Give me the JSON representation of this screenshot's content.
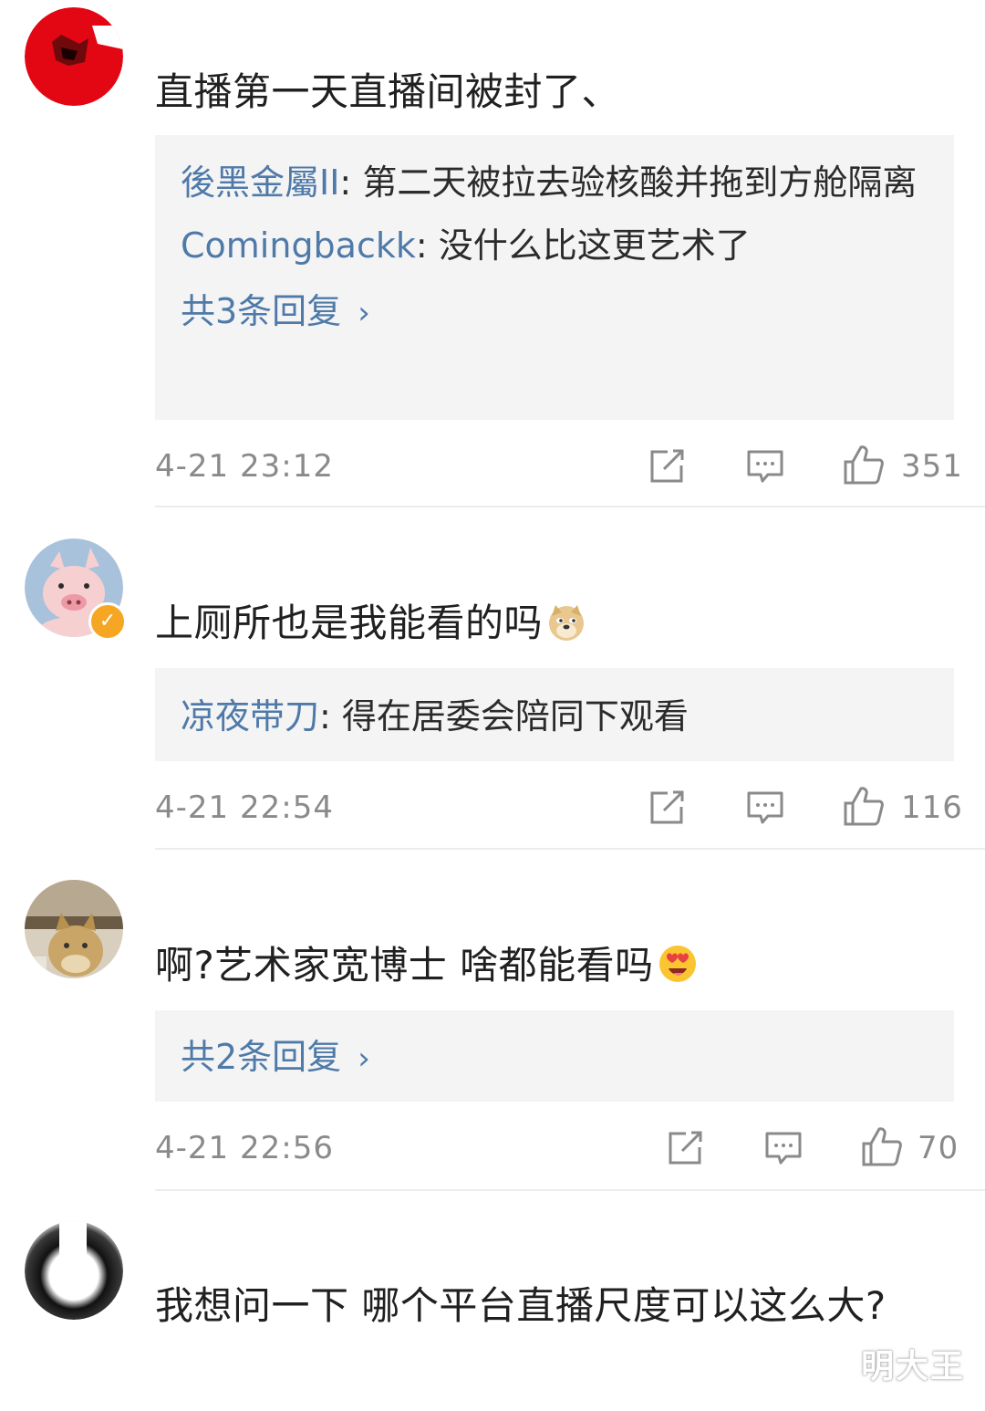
{
  "comments": [
    {
      "text": "直播第一天直播间被封了、",
      "replies": [
        {
          "name": "後黑金屬II",
          "sep": ": ",
          "text": "第二天被拉去验核酸并拖到方舱隔离"
        },
        {
          "name": "Comingbackk",
          "sep": ": ",
          "text": "没什么比这更艺术了"
        }
      ],
      "more_replies": "共3条回复",
      "time": "4-21 23:12",
      "likes": "351"
    },
    {
      "text": "上厕所也是我能看的吗",
      "emoji": "doge-emoji",
      "replies": [
        {
          "name": "凉夜带刀",
          "sep": ": ",
          "text": "得在居委会陪同下观看"
        }
      ],
      "time": "4-21 22:54",
      "likes": "116"
    },
    {
      "text": "啊?艺术家宽博士 啥都能看吗",
      "emoji": "heart-eyes-emoji",
      "more_replies": "共2条回复",
      "time": "4-21 22:56",
      "likes": "70"
    },
    {
      "text": "我想问一下 哪个平台直播尺度可以这么大?"
    }
  ],
  "icons": {
    "share": "share-icon",
    "comment": "comment-icon",
    "like": "thumbs-up-icon",
    "chevron": "chevron-right-icon"
  },
  "colors": {
    "username_link": "#4f7aa8",
    "reply_bg": "#f4f4f5",
    "meta_gray": "#8a8a8a"
  },
  "watermark": "明大王"
}
